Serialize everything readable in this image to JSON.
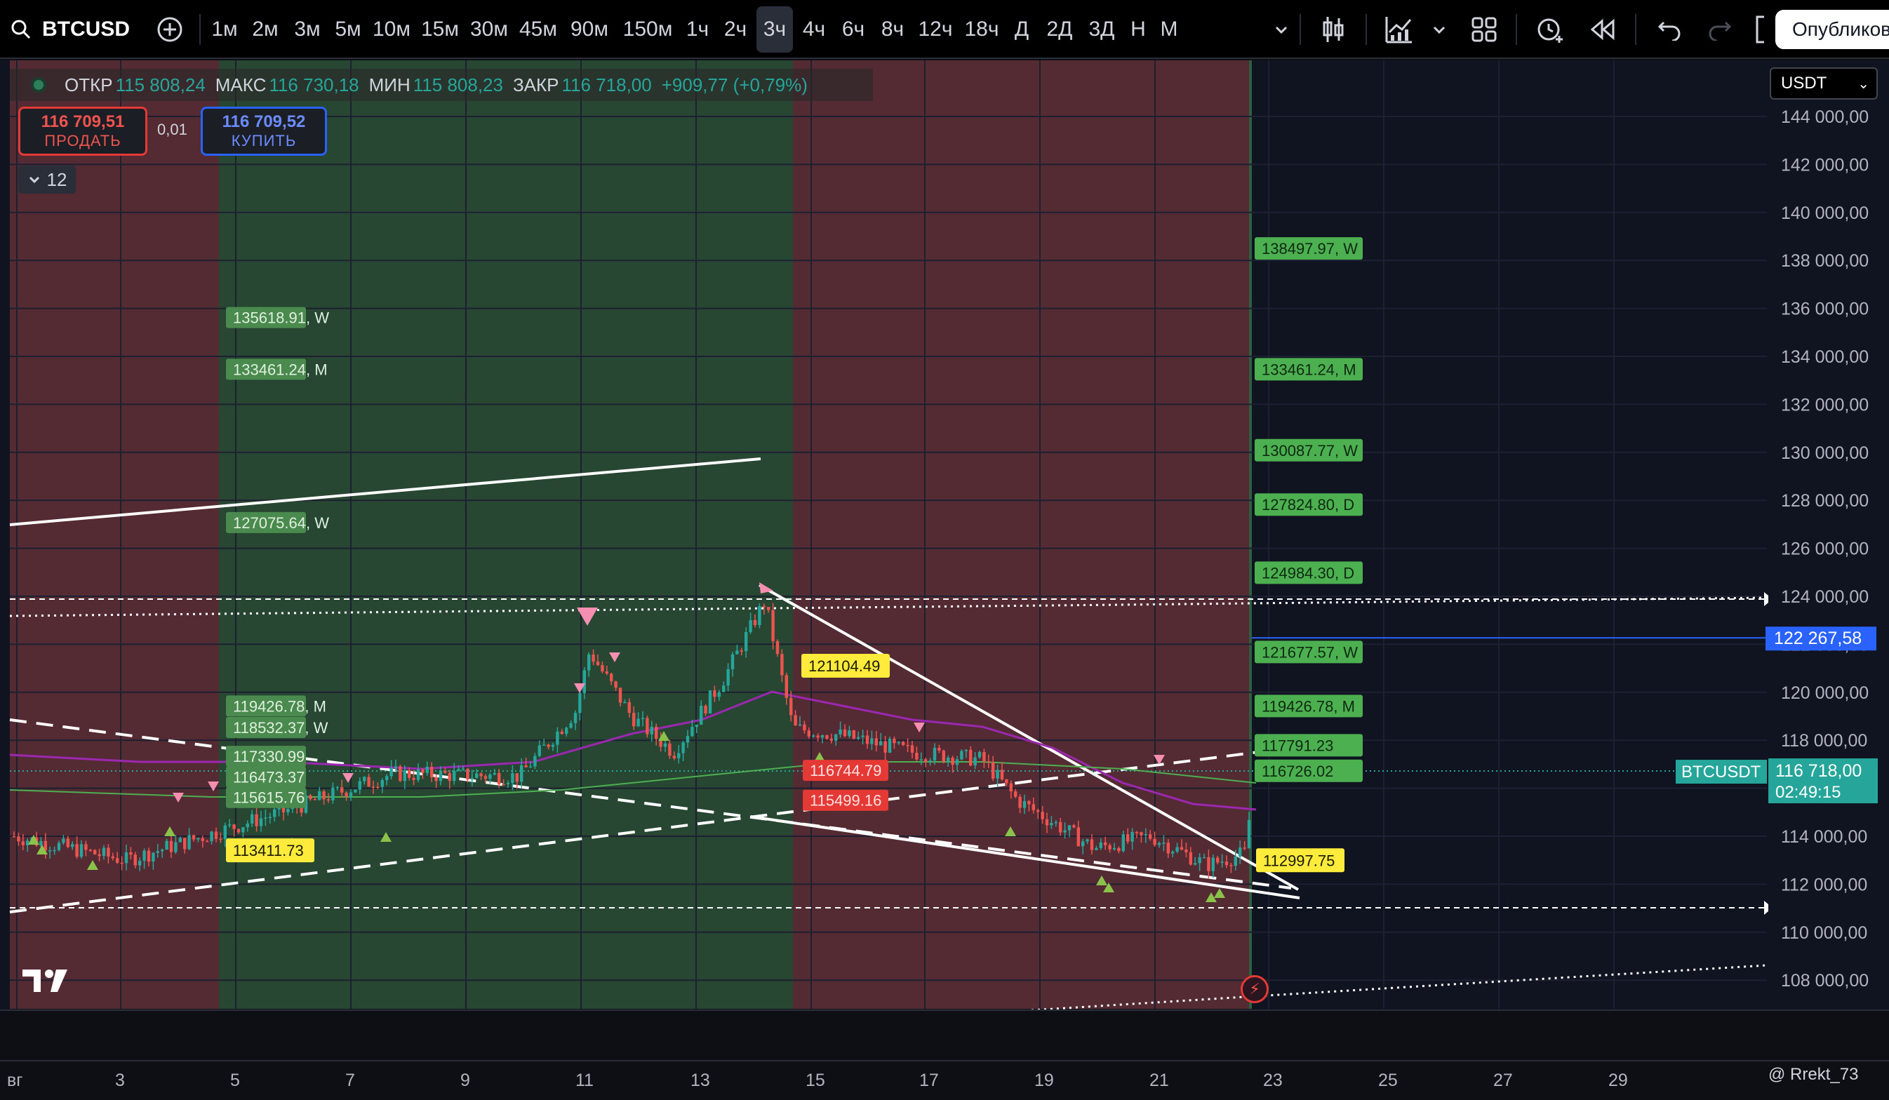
{
  "toolbar": {
    "symbol": "BTCUSD",
    "timeframes": [
      "1м",
      "2м",
      "3м",
      "5м",
      "10м",
      "15м",
      "30м",
      "45м",
      "90м",
      "150м",
      "1ч",
      "2ч",
      "3ч",
      "4ч",
      "6ч",
      "8ч",
      "12ч",
      "18ч",
      "Д",
      "2Д",
      "3Д",
      "Н",
      "М"
    ],
    "active_timeframe": "3ч",
    "publish_label": "Опубликов"
  },
  "legend": {
    "open_label": "ОТКР",
    "open": "115 808,24",
    "high_label": "МАКС",
    "high": "116 730,18",
    "low_label": "МИН",
    "low": "115 808,23",
    "close_label": "ЗАКР",
    "close": "116 718,00",
    "change": "+909,77 (+0,79%)"
  },
  "trade": {
    "sell_price": "116 709,51",
    "sell_label": "ПРОДАТЬ",
    "spread": "0,01",
    "buy_price": "116 709,52",
    "buy_label": "КУПИТЬ"
  },
  "indicators_count": "12",
  "currency": "USDT",
  "price_axis": [
    "144 000,00",
    "142 000,00",
    "140 000,00",
    "138 000,00",
    "136 000,00",
    "134 000,00",
    "132 000,00",
    "130 000,00",
    "128 000,00",
    "126 000,00",
    "124 000,00",
    "122 000,00",
    "120 000,00",
    "118 000,00",
    "116 000,00",
    "114 000,00",
    "112 000,00",
    "110 000,00",
    "108 000,00"
  ],
  "price_axis_values": [
    144000,
    142000,
    140000,
    138000,
    136000,
    134000,
    132000,
    130000,
    128000,
    126000,
    124000,
    122000,
    120000,
    118000,
    116000,
    114000,
    112000,
    110000,
    108000
  ],
  "time_axis": [
    "вг",
    "3",
    "5",
    "7",
    "9",
    "11",
    "13",
    "15",
    "17",
    "19",
    "21",
    "23",
    "25",
    "27",
    "29"
  ],
  "blue_line": {
    "label": "122 267,58",
    "value": 122267.58
  },
  "last_price": {
    "symbol": "BTCUSDT",
    "price": "116 718,00",
    "countdown": "02:49:15",
    "value": 116718
  },
  "levels_left": [
    {
      "label": "135618.91, W",
      "value": 135618.91
    },
    {
      "label": "133461.24, M",
      "value": 133461.24
    },
    {
      "label": "127075.64, W",
      "value": 127075.64
    },
    {
      "label": "119426.78, M",
      "value": 119426.78
    },
    {
      "label": "118532.37, W",
      "value": 118532.37
    },
    {
      "label": "117330.99",
      "value": 117330.99
    },
    {
      "label": "116473.37",
      "value": 116473.37
    },
    {
      "label": "115615.76",
      "value": 115615.76
    }
  ],
  "levels_right": [
    {
      "label": "138497.97, W",
      "value": 138497.97
    },
    {
      "label": "133461.24, M",
      "value": 133461.24
    },
    {
      "label": "130087.77, W",
      "value": 130087.77
    },
    {
      "label": "127824.80, D",
      "value": 127824.8
    },
    {
      "label": "124984.30, D",
      "value": 124984.3
    },
    {
      "label": "121677.57, W",
      "value": 121677.57
    },
    {
      "label": "119426.78, M",
      "value": 119426.78
    },
    {
      "label": "117791.23",
      "value": 117791.23
    },
    {
      "label": "116726.02",
      "value": 116726.02
    }
  ],
  "yellow_labels": [
    {
      "label": "121104.49",
      "value": 121104.49
    },
    {
      "label": "112997.75",
      "value": 112997.75
    },
    {
      "label": "113411.73",
      "value": 113411.73
    }
  ],
  "red_labels": [
    {
      "label": "116744.79",
      "value": 116744.79
    },
    {
      "label": "115499.16",
      "value": 115499.16
    }
  ],
  "author": "@ Rrekt_73",
  "colors": {
    "bull": "#26a69a",
    "bear": "#ef5350",
    "zone_red": "#5a2c35",
    "zone_green": "#2a4a35",
    "level_tag": "#4caf50",
    "yellow_tag": "#ffeb3b",
    "red_tag": "#e53935",
    "blue_line": "#2962ff",
    "ma_purple": "#9c27b0",
    "ma_green": "#4caf50"
  }
}
